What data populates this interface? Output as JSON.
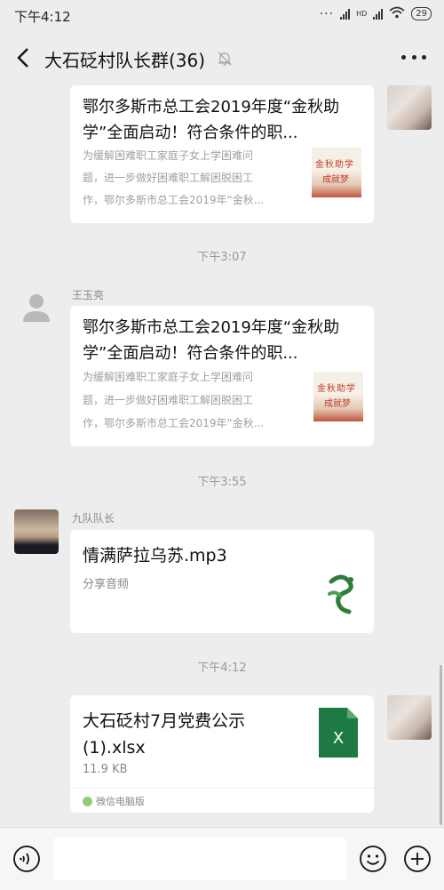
{
  "status": {
    "time": "下午4:12",
    "hd": "HD",
    "battery": "29"
  },
  "header": {
    "title": "大石砭村队长群(36)"
  },
  "icons": {
    "back": "chevron-left-icon",
    "muted": "bell-off-icon",
    "more": "more-dots-icon",
    "voice": "voice-icon",
    "emoji": "emoji-icon",
    "plus": "plus-icon",
    "excel": "excel-file-icon"
  },
  "colors": {
    "excel": "#1d7a45",
    "background": "#ededed"
  },
  "messages": [
    {
      "type": "article",
      "title": "鄂尔多斯市总工会2019年度“金秋助学”全面启动！符合条件的职...",
      "desc_lines": [
        "为缓解困难职工家庭子女上学困难问",
        "题，进一步做好困难职工解困脱困工",
        "作，鄂尔多斯市总工会2019年“金秋..."
      ],
      "thumb_text_1": "金秋助学",
      "thumb_text_2": "成就梦"
    },
    {
      "type": "time",
      "text": "下午3:07"
    },
    {
      "type": "article",
      "sender": "王玉亮",
      "title": "鄂尔多斯市总工会2019年度“金秋助学”全面启动！符合条件的职...",
      "desc_lines": [
        "为缓解困难职工家庭子女上学困难问",
        "题，进一步做好困难职工解困脱困工",
        "作，鄂尔多斯市总工会2019年“金秋..."
      ],
      "thumb_text_1": "金秋助学",
      "thumb_text_2": "成就梦"
    },
    {
      "type": "time",
      "text": "下午3:55"
    },
    {
      "type": "music",
      "sender": "九队队长",
      "title": "情满萨拉乌苏.mp3",
      "subtitle": "分享音频"
    },
    {
      "type": "time",
      "text": "下午4:12"
    },
    {
      "type": "file",
      "title_lines": [
        "大石砭村7月党费公示",
        "(1).xlsx"
      ],
      "size": "11.9 KB",
      "footer": "微信电脑版",
      "file_badge": "X"
    }
  ]
}
